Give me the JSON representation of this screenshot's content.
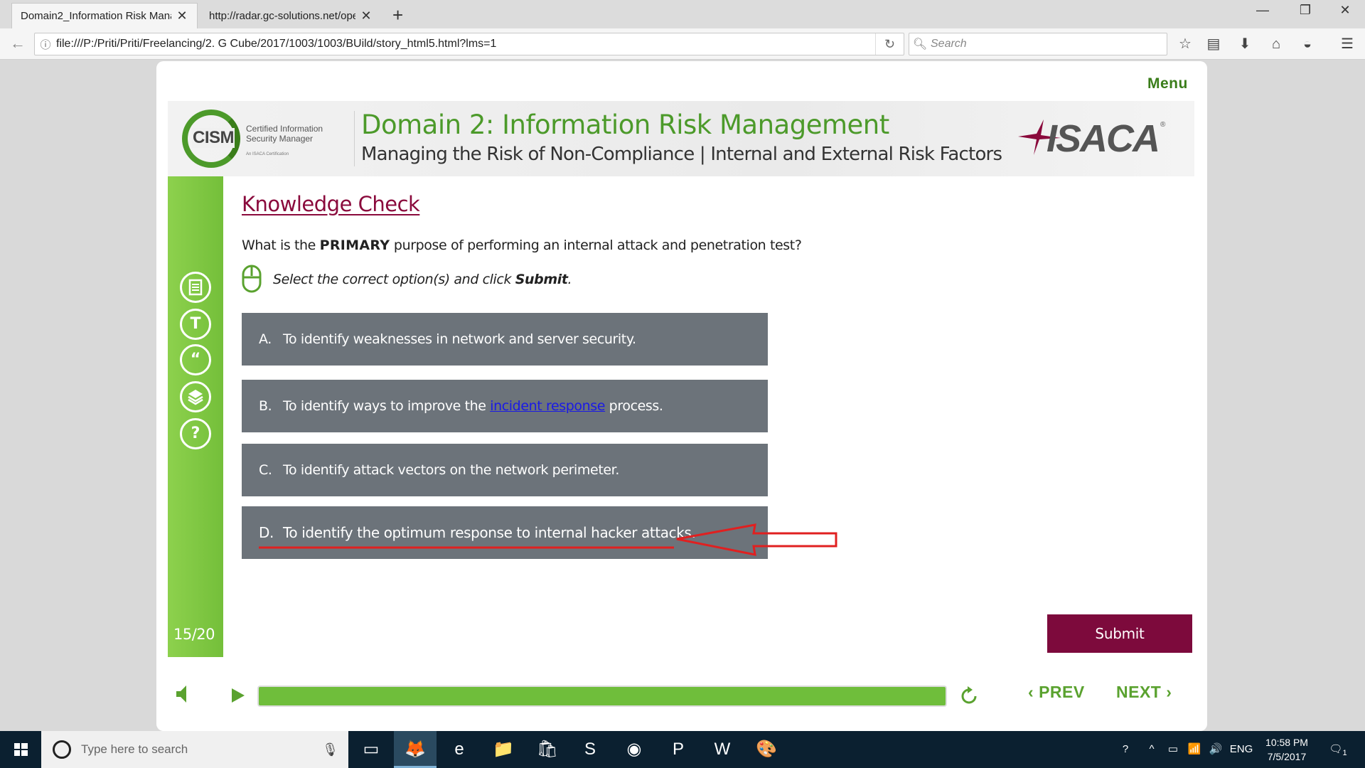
{
  "browser": {
    "tabs": [
      {
        "title": "Domain2_Information Risk Mana"
      },
      {
        "title": "http://radar.gc-solutions.net/ope"
      }
    ],
    "url": "file:///P:/Priti/Priti/Freelancing/2. G Cube/2017/1003/1003/BUild/story_html5.html?lms=1",
    "search_placeholder": "Search"
  },
  "course": {
    "menu_label": "Menu",
    "header": {
      "title": "Domain 2: Information Risk Management",
      "subtitle": "Managing the Risk of Non-Compliance | Internal and External Risk Factors",
      "cism_logo_word": "CISM",
      "cism_logo_text": "Certified Information Security Manager",
      "cism_logo_small": "An ISACA Certification",
      "isaca_logo_word": "ISACA"
    },
    "side_icons": [
      "notes-icon",
      "transcript-icon",
      "quote-icon",
      "resources-icon",
      "help-icon"
    ],
    "side_icon_glyphs": {
      "transcript": "T",
      "quote": "“",
      "help": "?"
    },
    "page_counter": "15/20",
    "heading": "Knowledge Check",
    "question": {
      "pre": "What is the ",
      "emphasis": "PRIMARY",
      "post": " purpose of performing an internal attack and penetration test?"
    },
    "instruction": {
      "pre": "Select the correct option(s) and click ",
      "emphasis": "Submit",
      "post": "."
    },
    "options": [
      {
        "letter": "A.",
        "text": "To identify weaknesses in network and server security."
      },
      {
        "letter": "B.",
        "pre": "To identify ways to improve the ",
        "link": "incident response",
        "post": " process."
      },
      {
        "letter": "C.",
        "text": "To identify attack vectors on the network perimeter."
      },
      {
        "letter": "D.",
        "text": "To identify the optimum response to internal hacker attacks."
      }
    ],
    "submit_label": "Submit",
    "prev_label": "PREV",
    "next_label": "NEXT",
    "progress_fraction": 1.0
  },
  "taskbar": {
    "search_placeholder": "Type here to search",
    "language": "ENG",
    "time": "10:58 PM",
    "date": "7/5/2017",
    "notification_count": "1"
  },
  "colors": {
    "accent_green": "#4c9a2a",
    "heading_maroon": "#8a0a3c",
    "submit_maroon": "#7d0a3c",
    "option_gray": "#6c737a",
    "annotation_red": "#e02020"
  }
}
